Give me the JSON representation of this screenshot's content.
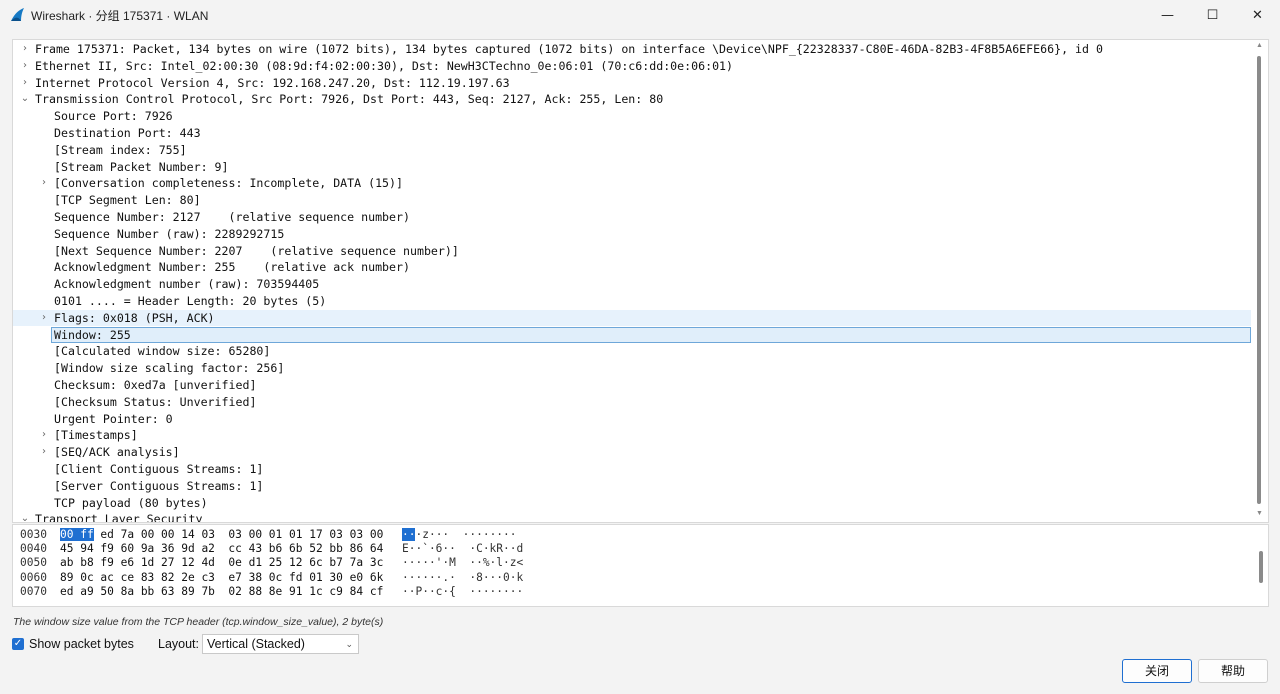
{
  "window": {
    "title": "Wireshark · 分组 175371 · WLAN",
    "minimize_glyph": "—",
    "maximize_glyph": "☐",
    "close_glyph": "✕"
  },
  "tree": {
    "rows": [
      {
        "text": "Frame 175371: Packet, 134 bytes on wire (1072 bits), 134 bytes captured (1072 bits) on interface \\Device\\NPF_{22328337-C80E-46DA-82B3-4F8B5A6EFE66}, id 0",
        "expander": "collapsed"
      },
      {
        "text": "Ethernet II, Src: Intel_02:00:30 (08:9d:f4:02:00:30), Dst: NewH3CTechno_0e:06:01 (70:c6:dd:0e:06:01)",
        "expander": "collapsed"
      },
      {
        "text": "Internet Protocol Version 4, Src: 192.168.247.20, Dst: 112.19.197.63",
        "expander": "collapsed"
      },
      {
        "text": "Transmission Control Protocol, Src Port: 7926, Dst Port: 443, Seq: 2127, Ack: 255, Len: 80",
        "expander": "expanded"
      },
      {
        "text": "Source Port: 7926",
        "expander": "none"
      },
      {
        "text": "Destination Port: 443",
        "expander": "none"
      },
      {
        "text": "[Stream index: 755]",
        "expander": "none"
      },
      {
        "text": "[Stream Packet Number: 9]",
        "expander": "none"
      },
      {
        "text": "[Conversation completeness: Incomplete, DATA (15)]",
        "expander": "collapsed"
      },
      {
        "text": "[TCP Segment Len: 80]",
        "expander": "none"
      },
      {
        "text": "Sequence Number: 2127    (relative sequence number)",
        "expander": "none"
      },
      {
        "text": "Sequence Number (raw): 2289292715",
        "expander": "none"
      },
      {
        "text": "[Next Sequence Number: 2207    (relative sequence number)]",
        "expander": "none"
      },
      {
        "text": "Acknowledgment Number: 255    (relative ack number)",
        "expander": "none"
      },
      {
        "text": "Acknowledgment number (raw): 703594405",
        "expander": "none"
      },
      {
        "text": "0101 .... = Header Length: 20 bytes (5)",
        "expander": "none"
      },
      {
        "text": "Flags: 0x018 (PSH, ACK)",
        "expander": "collapsed"
      },
      {
        "text": "Window: 255",
        "expander": "none"
      },
      {
        "text": "[Calculated window size: 65280]",
        "expander": "none"
      },
      {
        "text": "[Window size scaling factor: 256]",
        "expander": "none"
      },
      {
        "text": "Checksum: 0xed7a [unverified]",
        "expander": "none"
      },
      {
        "text": "[Checksum Status: Unverified]",
        "expander": "none"
      },
      {
        "text": "Urgent Pointer: 0",
        "expander": "none"
      },
      {
        "text": "[Timestamps]",
        "expander": "collapsed"
      },
      {
        "text": "[SEQ/ACK analysis]",
        "expander": "collapsed"
      },
      {
        "text": "[Client Contiguous Streams: 1]",
        "expander": "none"
      },
      {
        "text": "[Server Contiguous Streams: 1]",
        "expander": "none"
      },
      {
        "text": "TCP payload (80 bytes)",
        "expander": "none"
      },
      {
        "text": "Transport Layer Security",
        "expander": "expanded"
      }
    ],
    "hovered_row": "Flags: 0x018 (PSH, ACK)",
    "selected_row": "Window: 255"
  },
  "hex": {
    "rows": [
      {
        "offset": "0030",
        "sel_bytes": "00 ff",
        "bytes": " ed 7a 00 00 14 03  03 00 01 01 17 03 03 00",
        "sel_ascii": "··",
        "ascii": "·z···  ········"
      },
      {
        "offset": "0040",
        "sel_bytes": "",
        "bytes": "45 94 f9 60 9a 36 9d a2  cc 43 b6 6b 52 bb 86 64",
        "sel_ascii": "",
        "ascii": "E··`·6··  ·C·kR··d"
      },
      {
        "offset": "0050",
        "sel_bytes": "",
        "bytes": "ab b8 f9 e6 1d 27 12 4d  0e d1 25 12 6c b7 7a 3c",
        "sel_ascii": "",
        "ascii": "·····'·M  ··%·l·z<"
      },
      {
        "offset": "0060",
        "sel_bytes": "",
        "bytes": "89 0c ac ce 83 82 2e c3  e7 38 0c fd 01 30 e0 6k",
        "sel_ascii": "",
        "ascii": "······.·  ·8···0·k"
      },
      {
        "offset": "0070",
        "sel_bytes": "",
        "bytes": "ed a9 50 8a bb 63 89 7b  02 88 8e 91 1c c9 84 cf",
        "sel_ascii": "",
        "ascii": "··P··c·{  ········"
      }
    ]
  },
  "status": {
    "text": "The window size value from the TCP header (tcp.window_size_value), 2 byte(s)"
  },
  "options": {
    "show_bytes_label": "Show packet bytes",
    "show_bytes_checked": true,
    "layout_label": "Layout:",
    "layout_value": "Vertical (Stacked)"
  },
  "buttons": {
    "close_label": "关闭",
    "help_label": "帮助"
  },
  "colors": {
    "accent": "#1f6fd1",
    "hover_row": "#e7f2fc",
    "selected_row_border": "#6ea7d9"
  }
}
